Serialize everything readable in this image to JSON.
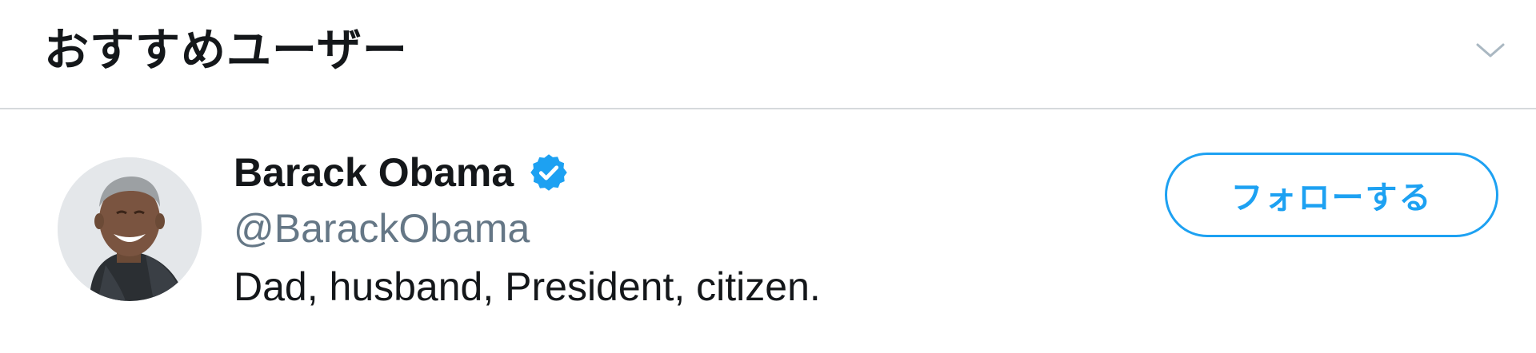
{
  "header": {
    "title": "おすすめユーザー",
    "collapse_icon": "chevron-down-icon"
  },
  "suggestions": [
    {
      "display_name": "Barack Obama",
      "handle": "@BarackObama",
      "bio": "Dad, husband, President, citizen.",
      "verified": true,
      "verified_icon": "verified-badge-icon",
      "follow_label": "フォローする"
    }
  ],
  "colors": {
    "accent": "#1da1f2",
    "text_primary": "#14171a",
    "text_secondary": "#657786",
    "divider": "#d6d9dc"
  }
}
